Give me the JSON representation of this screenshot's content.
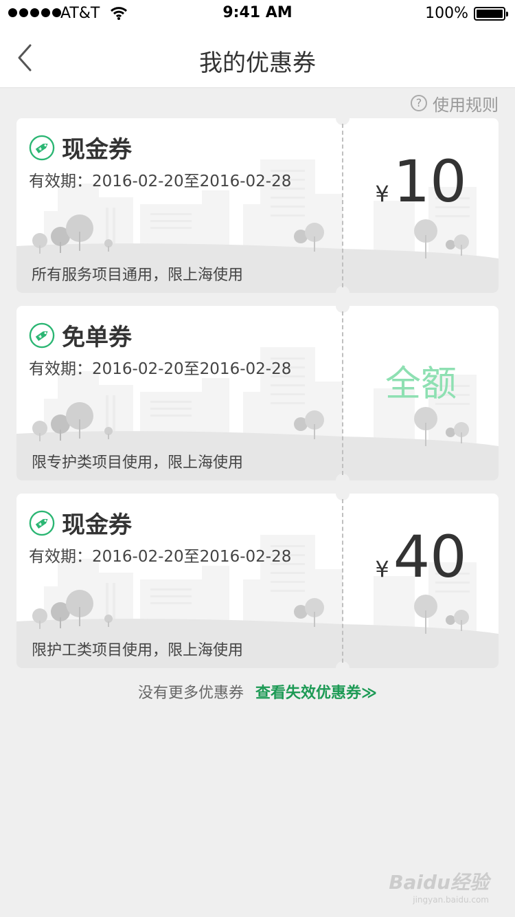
{
  "status_bar": {
    "carrier": "AT&T",
    "time": "9:41 AM",
    "battery": "100%",
    "battery_level": 1.0
  },
  "nav": {
    "title": "我的优惠券",
    "back_icon": "chevron-left-icon"
  },
  "rules": {
    "label": "使用规则",
    "icon_glyph": "?"
  },
  "coupons": [
    {
      "title": "现金券",
      "validity": "有效期：2016-02-20至2016-02-28",
      "currency": "¥",
      "amount": "10",
      "note": "所有服务项目通用，限上海使用"
    },
    {
      "title": "免单券",
      "validity": "有效期：2016-02-20至2016-02-28",
      "amount_text": "全额",
      "note": "限专护类项目使用，限上海使用"
    },
    {
      "title": "现金券",
      "validity": "有效期：2016-02-20至2016-02-28",
      "currency": "¥",
      "amount": "40",
      "note": "限护工类项目使用，限上海使用"
    }
  ],
  "footer": {
    "no_more": "没有更多优惠券",
    "view_expired": "查看失效优惠券≫"
  },
  "watermark": {
    "brand": "Baidu经验",
    "url": "jingyan.baidu.com"
  },
  "colors": {
    "accent_green": "#1d9a55",
    "full_amount_green": "#8ee0b2",
    "background": "#efefef"
  }
}
